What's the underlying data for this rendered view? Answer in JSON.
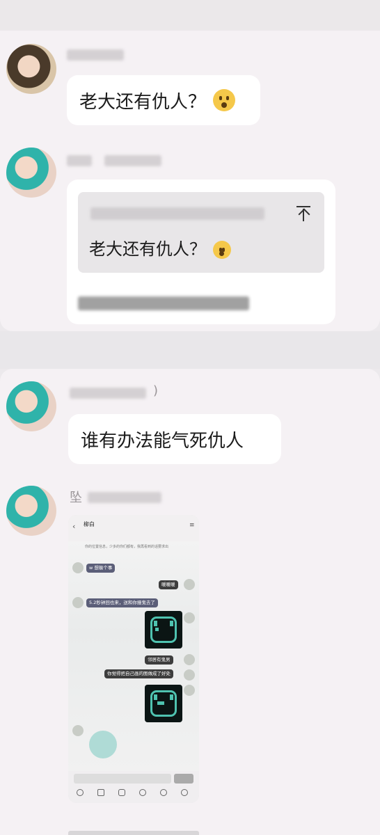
{
  "messages": {
    "m1": {
      "text": "老大还有仇人？",
      "emoji": "frowning-face"
    },
    "m2": {
      "quote_text": "老大还有仇人？",
      "quote_emoji": "frowning-face"
    },
    "m3": {
      "text": "谁有办法能气死仇人",
      "sender_fragment": ")"
    },
    "m4": {
      "sender_fragment": "坠"
    }
  },
  "screenshot": {
    "title": "柳白",
    "note_line": "你的位置信息，少多的你们都有，我再看到的话要求出",
    "bubbles": [
      "w 想躲个事",
      "暖暖暖",
      "5.2秒钟回也来，送和你撞鬼去了",
      "邻居有鬼男",
      "你觉得把自己画的图做成了好处"
    ]
  }
}
